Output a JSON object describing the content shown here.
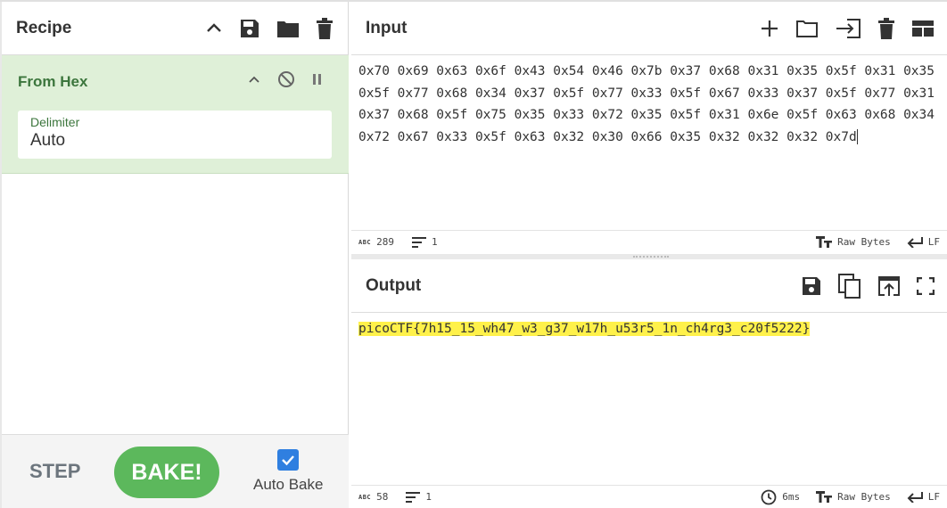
{
  "recipe": {
    "title": "Recipe",
    "operation": {
      "name": "From Hex",
      "arg_label": "Delimiter",
      "arg_value": "Auto"
    },
    "step_label": "STEP",
    "bake_label": "BAKE!",
    "autobake_label": "Auto Bake",
    "autobake_checked": true
  },
  "input": {
    "title": "Input",
    "text": "0x70 0x69 0x63 0x6f 0x43 0x54 0x46 0x7b 0x37 0x68 0x31 0x35 0x5f 0x31 0x35 0x5f 0x77 0x68 0x34 0x37 0x5f 0x77 0x33 0x5f 0x67 0x33 0x37 0x5f 0x77 0x31 0x37 0x68 0x5f 0x75 0x35 0x33 0x72 0x35 0x5f 0x31 0x6e 0x5f 0x63 0x68 0x34 0x72 0x67 0x33 0x5f 0x63 0x32 0x30 0x66 0x35 0x32 0x32 0x32 0x7d",
    "length": "289",
    "lines": "1",
    "encoding": "Raw Bytes",
    "eol": "LF"
  },
  "output": {
    "title": "Output",
    "text": "picoCTF{7h15_15_wh47_w3_g37_w17h_u53r5_1n_ch4rg3_c20f5222}",
    "length": "58",
    "lines": "1",
    "time": "6ms",
    "encoding": "Raw Bytes",
    "eol": "LF"
  },
  "colors": {
    "operation_bg": "#dff0d8",
    "operation_text": "#3c763d",
    "bake_button": "#5cb85c",
    "checkbox": "#2f7fe0",
    "highlight": "#fff14a"
  }
}
